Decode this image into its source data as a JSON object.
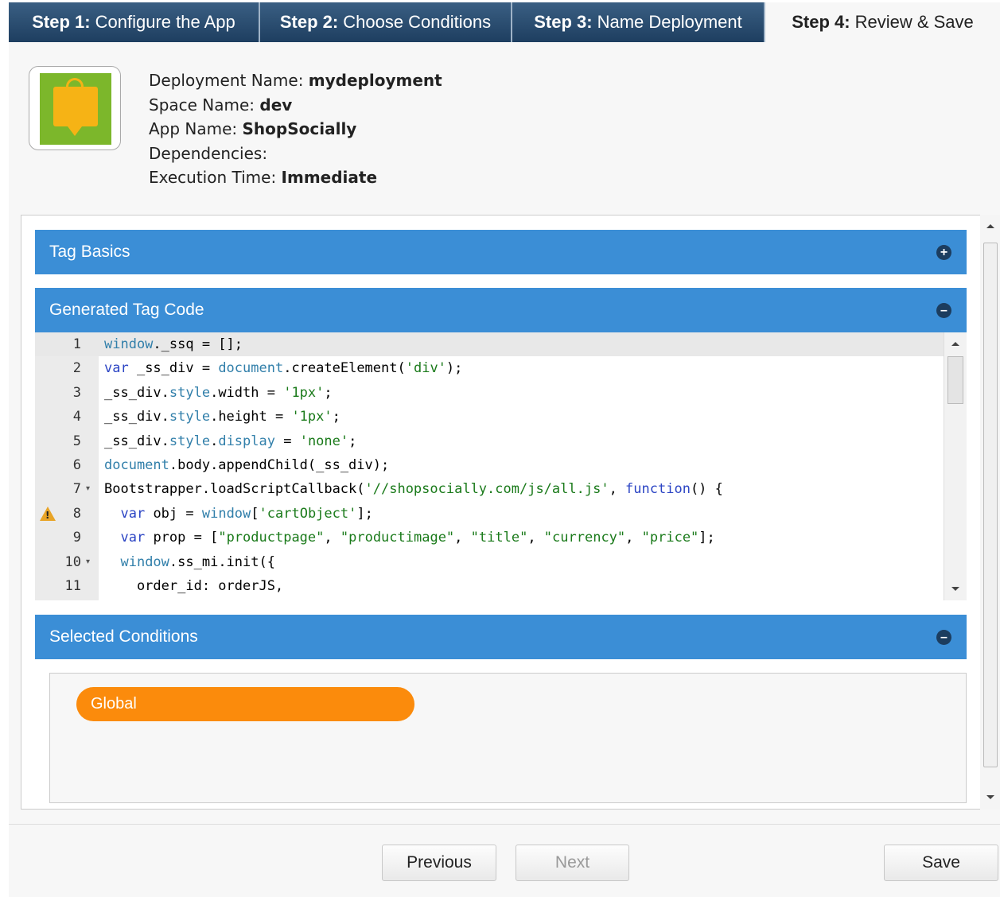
{
  "steps": [
    {
      "num": "Step 1:",
      "label": "Configure the App"
    },
    {
      "num": "Step 2:",
      "label": "Choose Conditions"
    },
    {
      "num": "Step 3:",
      "label": "Name Deployment"
    },
    {
      "num": "Step 4:",
      "label": "Review & Save"
    }
  ],
  "summary": {
    "deployment_label": "Deployment Name: ",
    "deployment_value": "mydeployment",
    "space_label": "Space Name: ",
    "space_value": "dev",
    "app_label": "App Name: ",
    "app_value": "ShopSocially",
    "dependencies_label": "Dependencies:",
    "execution_label": "Execution Time: ",
    "execution_value": "Immediate"
  },
  "sections": {
    "tag_basics": "Tag Basics",
    "generated_code": "Generated Tag Code",
    "selected_conditions": "Selected Conditions"
  },
  "code_lines": [
    {
      "n": "1"
    },
    {
      "n": "2"
    },
    {
      "n": "3"
    },
    {
      "n": "4"
    },
    {
      "n": "5"
    },
    {
      "n": "6"
    },
    {
      "n": "7"
    },
    {
      "n": "8"
    },
    {
      "n": "9"
    },
    {
      "n": "10"
    },
    {
      "n": "11"
    }
  ],
  "conditions": [
    "Global"
  ],
  "buttons": {
    "previous": "Previous",
    "next": "Next",
    "save": "Save"
  },
  "icons": {
    "expand": "plus-circle-icon",
    "collapse": "minus-circle-icon",
    "warning": "warning-icon"
  },
  "colors": {
    "accent": "#3b8ed6",
    "condition": "#fb8b0c",
    "nav": "#2a4c70"
  }
}
